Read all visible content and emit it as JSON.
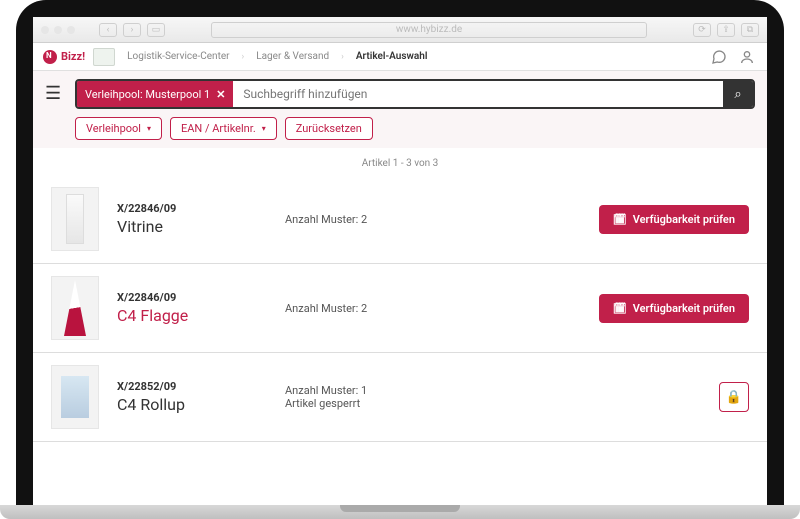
{
  "browser": {
    "url": "www.hybizz.de"
  },
  "brand": "Bizz!",
  "breadcrumb": {
    "a": "Logistik-Service-Center",
    "b": "Lager & Versand",
    "c": "Artikel-Auswahl"
  },
  "search": {
    "chip_label": "Verleihpool: Musterpool 1",
    "placeholder": "Suchbegriff hinzufügen"
  },
  "filters": {
    "pool": "Verleihpool",
    "ean": "EAN / Artikelnr.",
    "reset": "Zurücksetzen"
  },
  "count_text": "Artikel 1 - 3 von 3",
  "availability_label": "Verfügbarkeit prüfen",
  "articles": [
    {
      "sku": "X/22846/09",
      "title": "Vitrine",
      "title_red": false,
      "meta": "Anzahl Muster: 2",
      "meta2": "",
      "locked": false
    },
    {
      "sku": "X/22846/09",
      "title": "C4 Flagge",
      "title_red": true,
      "meta": "Anzahl Muster: 2",
      "meta2": "",
      "locked": false
    },
    {
      "sku": "X/22852/09",
      "title": "C4 Rollup",
      "title_red": false,
      "meta": "Anzahl Muster: 1",
      "meta2": "Artikel gesperrt",
      "locked": true
    }
  ]
}
